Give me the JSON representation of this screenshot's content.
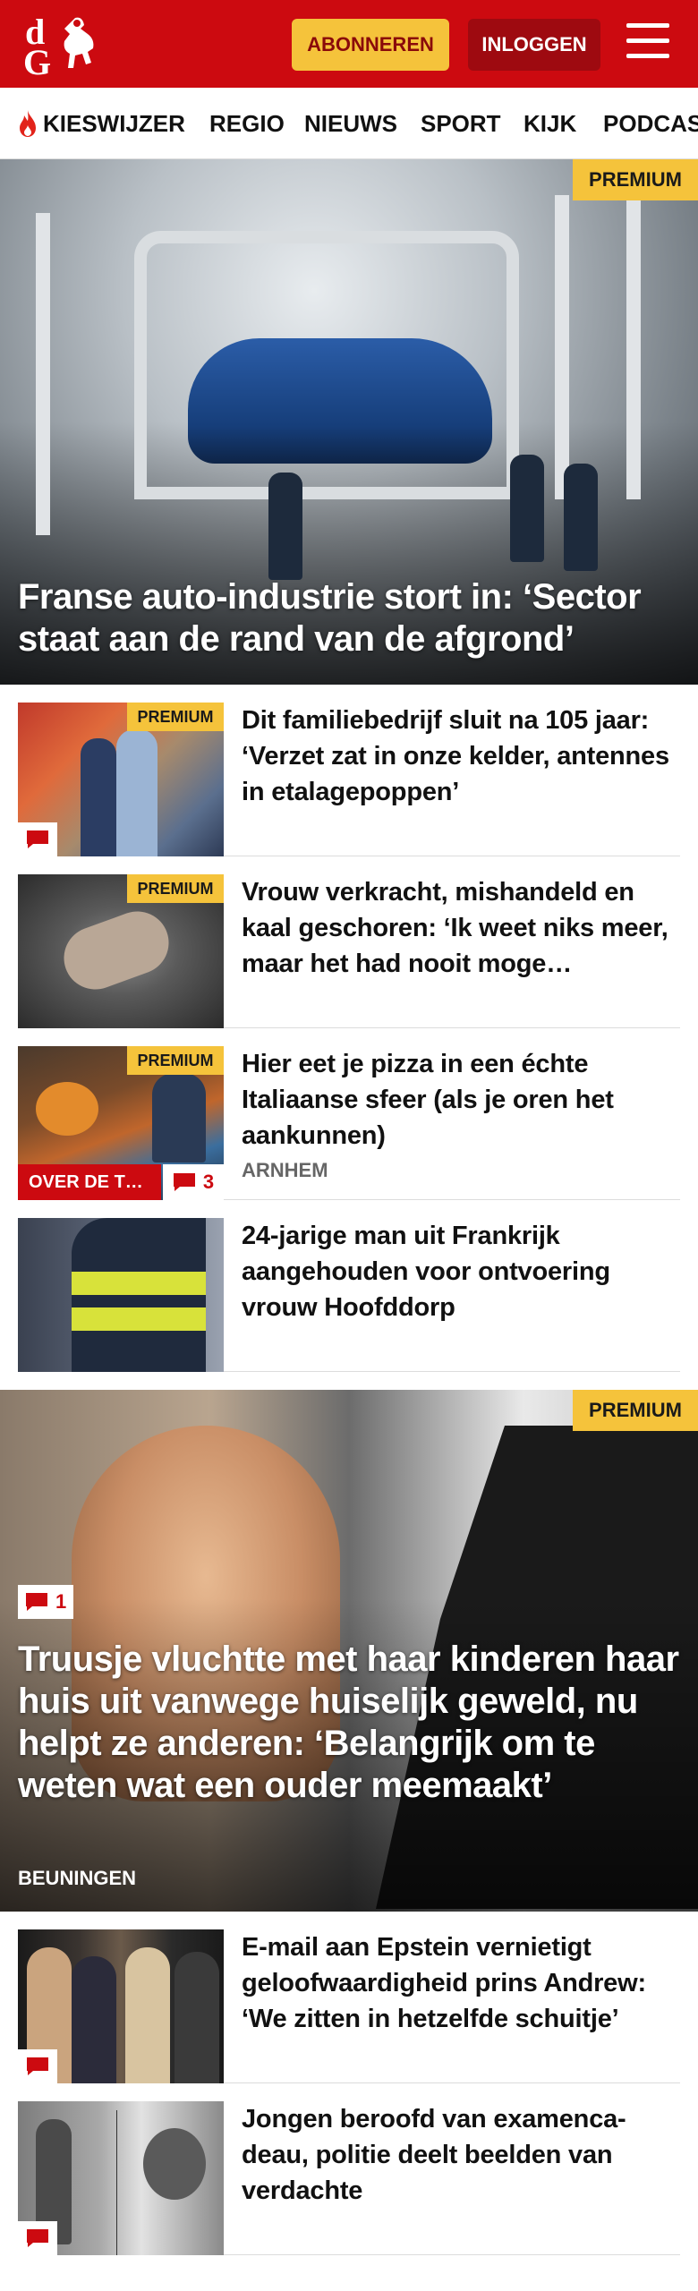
{
  "header": {
    "logo_letters": [
      "d",
      "G"
    ],
    "subscribe_label": "ABONNEREN",
    "login_label": "INLOGGEN",
    "brand_color": "#cc0a10",
    "subscribe_color": "#f5c33b"
  },
  "nav": {
    "items": [
      "KIESWIJZER",
      "REGIO",
      "NIEUWS",
      "SPORT",
      "KIJK",
      "PODCAS"
    ]
  },
  "hero": {
    "badge": "PREMIUM",
    "title": "Franse auto-industrie stort in: ‘Sector staat aan de rand van de afgrond’"
  },
  "articles": [
    {
      "title": "Dit familiebedrijf sluit na 105 jaar: ‘Verzet zat in onze kelder, antennes in etalagepoppen’",
      "badge": "PREMIUM",
      "has_comment": true
    },
    {
      "title": "Vrouw verkracht, mishandeld en kaal geschoren: ‘Ik weet niks meer, maar het had nooit moge…",
      "badge": "PREMIUM"
    },
    {
      "title": "Hier eet je pizza in een échte Italiaanse sfeer (als je oren het aankunnen)",
      "badge": "PREMIUM",
      "tag": "ARNHEM",
      "label": "OVER DE T…",
      "comments": "3"
    },
    {
      "title": "24-jarige man uit Frankrijk aangehouden voor ontvoering vrouw Hoofddorp"
    }
  ],
  "hero2": {
    "badge": "PREMIUM",
    "comments": "1",
    "title": "Truusje vluchtte met haar kinderen haar huis uit vanwege huiselijk geweld, nu helpt ze anderen: ‘Belangrijk om te weten wat een ouder meemaakt’",
    "tag": "BEUNINGEN"
  },
  "articles2": [
    {
      "title": "E-mail aan Epstein vernietigt geloofwaardigheid prins Andrew: ‘We zitten in hetzelfde schuitje’",
      "has_comment": true
    },
    {
      "title": "Jongen beroofd van examenca-deau, politie deelt beelden van verdachte",
      "has_comment": true
    }
  ]
}
